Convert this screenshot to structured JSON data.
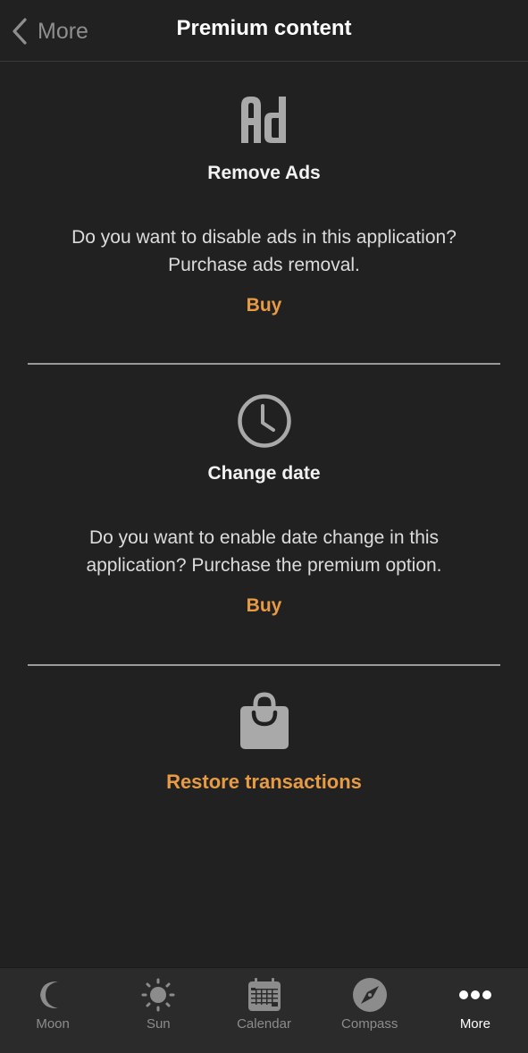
{
  "navbar": {
    "back_label": "More",
    "back_icon": "chevron-left-icon",
    "title": "Premium content"
  },
  "sections": [
    {
      "icon": "ad-icon",
      "icon_text": "Ad",
      "title": "Remove Ads",
      "description": "Do you want to disable ads in this application? Purchase ads removal.",
      "buy_label": "Buy"
    },
    {
      "icon": "clock-icon",
      "title": "Change date",
      "description": "Do you want to enable date change in this application? Purchase the premium option.",
      "buy_label": "Buy"
    }
  ],
  "restore": {
    "icon": "shopping-bag-icon",
    "label": "Restore transactions"
  },
  "tabbar": {
    "items": [
      {
        "label": "Moon",
        "icon": "moon-icon",
        "active": false
      },
      {
        "label": "Sun",
        "icon": "sun-icon",
        "active": false
      },
      {
        "label": "Calendar",
        "icon": "calendar-icon",
        "active": false
      },
      {
        "label": "Compass",
        "icon": "compass-icon",
        "active": false
      },
      {
        "label": "More",
        "icon": "more-icon",
        "active": true
      }
    ]
  },
  "colors": {
    "background": "#212121",
    "accent": "#e79b45",
    "icon_gray": "#a9a9a9",
    "tabbar_background": "#2b2b2b",
    "inactive_tab": "#8c8c8c",
    "active_tab": "#ffffff"
  }
}
